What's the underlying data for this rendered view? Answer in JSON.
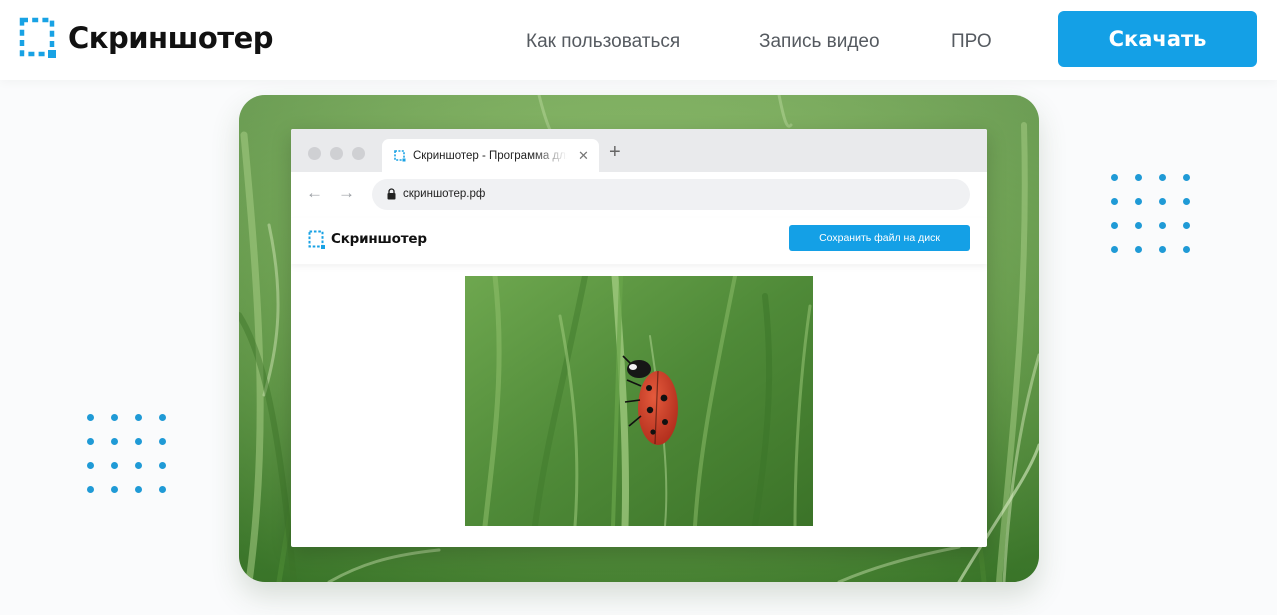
{
  "header": {
    "logo_text": "Скриншотер",
    "nav": {
      "how_to_use": "Как пользоваться",
      "video_record": "Запись видео",
      "pro": "ПРО"
    },
    "download_label": "Скачать"
  },
  "browser": {
    "tab_title": "Скриншотер - Программа для",
    "new_tab_icon": "plus-icon",
    "close_icon": "close-icon",
    "url": "скриншотер.рф",
    "site": {
      "logo_text": "Скриншотер",
      "save_button_label": "Сохранить файл на диск"
    },
    "preview_image": "ladybug-on-grass-photo"
  },
  "colors": {
    "accent": "#14a0e6",
    "dots": "#1f9ad6",
    "grass": "#5f9a43"
  }
}
